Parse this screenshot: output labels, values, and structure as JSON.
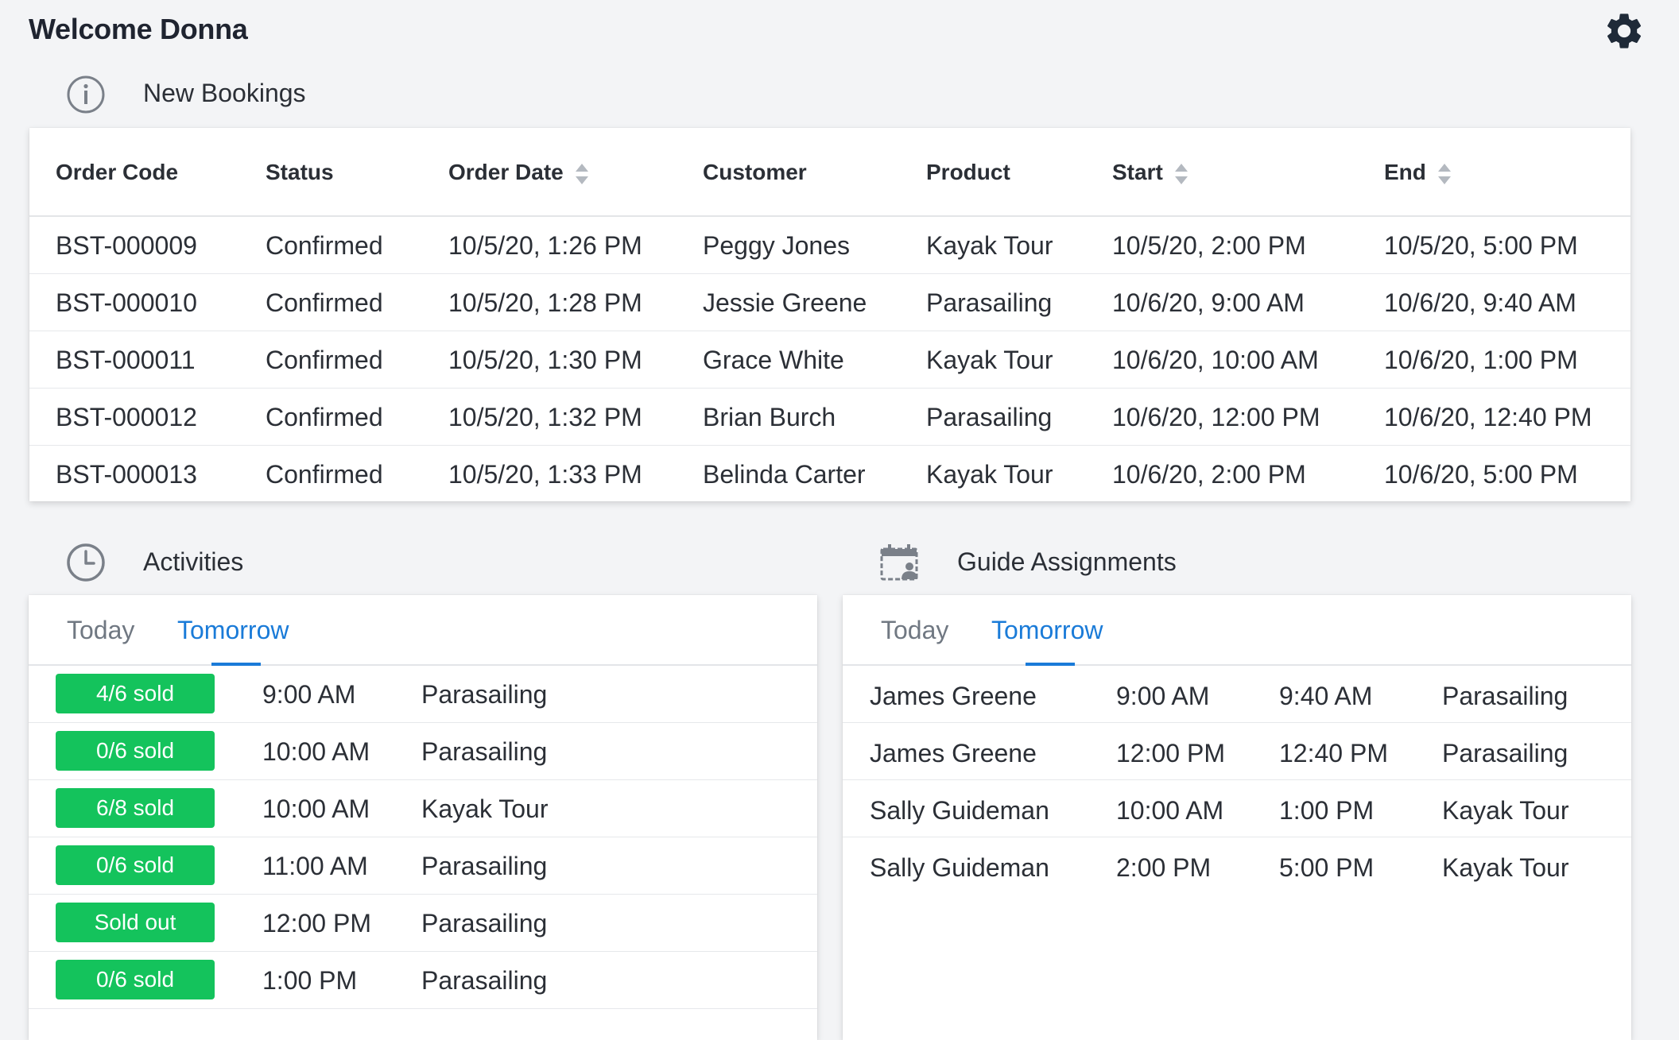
{
  "header": {
    "welcome": "Welcome Donna"
  },
  "icons": {
    "settings": "gear-icon",
    "bookings": "info-circle-icon",
    "activities": "clock-icon",
    "guides": "calendar-user-icon"
  },
  "colors": {
    "accent": "#1a7bd8",
    "badge_green": "#14c35c",
    "background": "#f3f4f6"
  },
  "bookings": {
    "title": "New Bookings",
    "columns": [
      "Order Code",
      "Status",
      "Order Date",
      "Customer",
      "Product",
      "Start",
      "End"
    ],
    "sortable_columns": [
      "Order Date",
      "Start",
      "End"
    ],
    "rows": [
      [
        "BST-000009",
        "Confirmed",
        "10/5/20, 1:26 PM",
        "Peggy Jones",
        "Kayak Tour",
        "10/5/20, 2:00 PM",
        "10/5/20, 5:00 PM"
      ],
      [
        "BST-000010",
        "Confirmed",
        "10/5/20, 1:28 PM",
        "Jessie Greene",
        "Parasailing",
        "10/6/20, 9:00 AM",
        "10/6/20, 9:40 AM"
      ],
      [
        "BST-000011",
        "Confirmed",
        "10/5/20, 1:30 PM",
        "Grace White",
        "Kayak Tour",
        "10/6/20, 10:00 AM",
        "10/6/20, 1:00 PM"
      ],
      [
        "BST-000012",
        "Confirmed",
        "10/5/20, 1:32 PM",
        "Brian Burch",
        "Parasailing",
        "10/6/20, 12:00 PM",
        "10/6/20, 12:40 PM"
      ],
      [
        "BST-000013",
        "Confirmed",
        "10/5/20, 1:33 PM",
        "Belinda Carter",
        "Kayak Tour",
        "10/6/20, 2:00 PM",
        "10/6/20, 5:00 PM"
      ]
    ]
  },
  "activities": {
    "title": "Activities",
    "tabs": [
      {
        "label": "Today",
        "active": false
      },
      {
        "label": "Tomorrow",
        "active": true
      }
    ],
    "rows": [
      {
        "badge": "4/6 sold",
        "time": "9:00 AM",
        "product": "Parasailing"
      },
      {
        "badge": "0/6 sold",
        "time": "10:00 AM",
        "product": "Parasailing"
      },
      {
        "badge": "6/8 sold",
        "time": "10:00 AM",
        "product": "Kayak Tour"
      },
      {
        "badge": "0/6 sold",
        "time": "11:00 AM",
        "product": "Parasailing"
      },
      {
        "badge": "Sold out",
        "time": "12:00 PM",
        "product": "Parasailing"
      },
      {
        "badge": "0/6 sold",
        "time": "1:00 PM",
        "product": "Parasailing"
      }
    ]
  },
  "guides": {
    "title": "Guide Assignments",
    "tabs": [
      {
        "label": "Today",
        "active": false
      },
      {
        "label": "Tomorrow",
        "active": true
      }
    ],
    "rows": [
      {
        "guide": "James Greene",
        "start": "9:00 AM",
        "end": "9:40 AM",
        "product": "Parasailing"
      },
      {
        "guide": "James Greene",
        "start": "12:00 PM",
        "end": "12:40 PM",
        "product": "Parasailing"
      },
      {
        "guide": "Sally Guideman",
        "start": "10:00 AM",
        "end": "1:00 PM",
        "product": "Kayak Tour"
      },
      {
        "guide": "Sally Guideman",
        "start": "2:00 PM",
        "end": "5:00 PM",
        "product": "Kayak Tour"
      }
    ]
  }
}
